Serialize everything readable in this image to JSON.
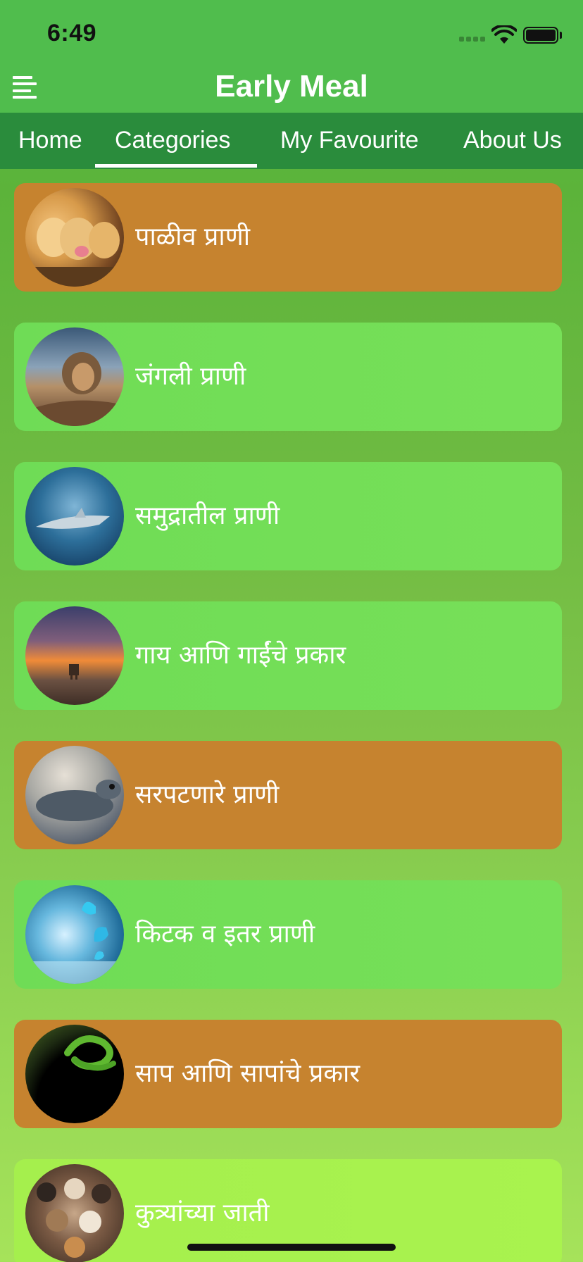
{
  "status_bar": {
    "time": "6:49"
  },
  "header": {
    "title": "Early Meal",
    "menu_icon": "menu-icon"
  },
  "tabs": [
    {
      "label": "Home",
      "active": false
    },
    {
      "label": "Categories",
      "active": true
    },
    {
      "label": "My Favourite",
      "active": false
    },
    {
      "label": "About Us",
      "active": false
    }
  ],
  "categories": [
    {
      "label": "पाळीव प्राणी",
      "style": "orange",
      "thumb": "pets"
    },
    {
      "label": "जंगली प्राणी",
      "style": "green",
      "thumb": "lion"
    },
    {
      "label": "समुद्रातील प्राणी",
      "style": "green",
      "thumb": "sea"
    },
    {
      "label": "गाय आणि गाईंचे प्रकार",
      "style": "green",
      "thumb": "cow"
    },
    {
      "label": "सरपटणारे प्राणी",
      "style": "orange",
      "thumb": "turtle"
    },
    {
      "label": "किटक व इतर प्राणी",
      "style": "green",
      "thumb": "butterfly"
    },
    {
      "label": "साप आणि सापांचे प्रकार",
      "style": "orange",
      "thumb": "snake"
    },
    {
      "label": "कुत्र्यांच्या जाती",
      "style": "green",
      "thumb": "dogs"
    }
  ],
  "colors": {
    "header_bg": "#50bd4d",
    "tabs_bg": "#2a8c3c",
    "card_orange": "#c6832f",
    "card_green": "#6fdc56",
    "text": "#ffffff"
  }
}
